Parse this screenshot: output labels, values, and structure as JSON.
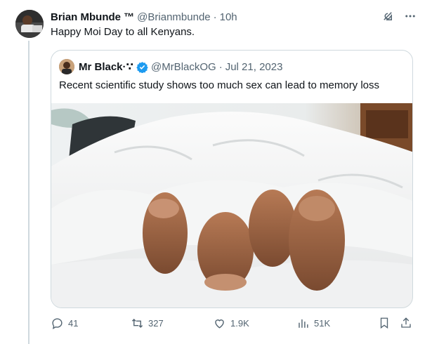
{
  "tweet": {
    "author_name": "Brian Mbunde ™",
    "author_handle": "@Brianmbunde",
    "separator": "·",
    "time": "10h",
    "text": "Happy Moi Day to all Kenyans."
  },
  "quote": {
    "author_name": "Mr Black·∵",
    "author_handle": "@MrBlackOG",
    "separator": "·",
    "date": "Jul 21, 2023",
    "text": "Recent scientific study shows too much sex can lead to memory loss",
    "verified_color": "#1d9bf0"
  },
  "actions": {
    "replies": "41",
    "reposts": "327",
    "likes": "1.9K",
    "views": "51K"
  },
  "icons": {
    "header": [
      "grok-icon",
      "more-icon"
    ],
    "actions": [
      "reply-icon",
      "repost-icon",
      "like-icon",
      "views-icon",
      "bookmark-icon",
      "share-icon"
    ]
  },
  "colors": {
    "text_primary": "#0f1419",
    "text_secondary": "#536471",
    "border": "#cfd9de",
    "accent": "#1d9bf0"
  }
}
